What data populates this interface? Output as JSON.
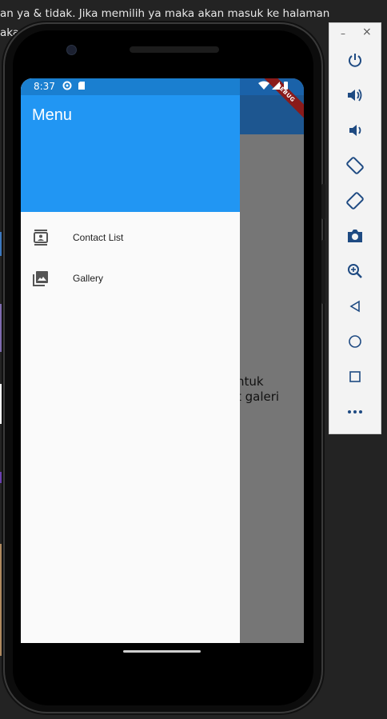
{
  "background": {
    "text_line1": "an ya & tidak. Jika memilih ya maka akan masuk ke halaman",
    "text_line2": "aka"
  },
  "status_bar": {
    "time": "8:37",
    "debug_label": "DEBUG"
  },
  "app_body": {
    "text_line1": "ntuk",
    "text_line2": "t galeri"
  },
  "drawer": {
    "title": "Menu",
    "items": [
      {
        "label": "Contact List",
        "icon": "contacts-icon"
      },
      {
        "label": "Gallery",
        "icon": "photo-album-icon"
      }
    ]
  },
  "emulator_toolbar": {
    "minimize": "–",
    "close": "×",
    "buttons": [
      "power-icon",
      "volume-up-icon",
      "volume-down-icon",
      "rotate-left-icon",
      "rotate-right-icon",
      "camera-icon",
      "zoom-icon",
      "back-icon",
      "home-icon",
      "overview-icon",
      "more-icon"
    ]
  },
  "colors": {
    "primary": "#2196f3",
    "primary_dark": "#1a62a9",
    "appbar_dimmed": "#1d5690",
    "scrim": "#767676"
  }
}
